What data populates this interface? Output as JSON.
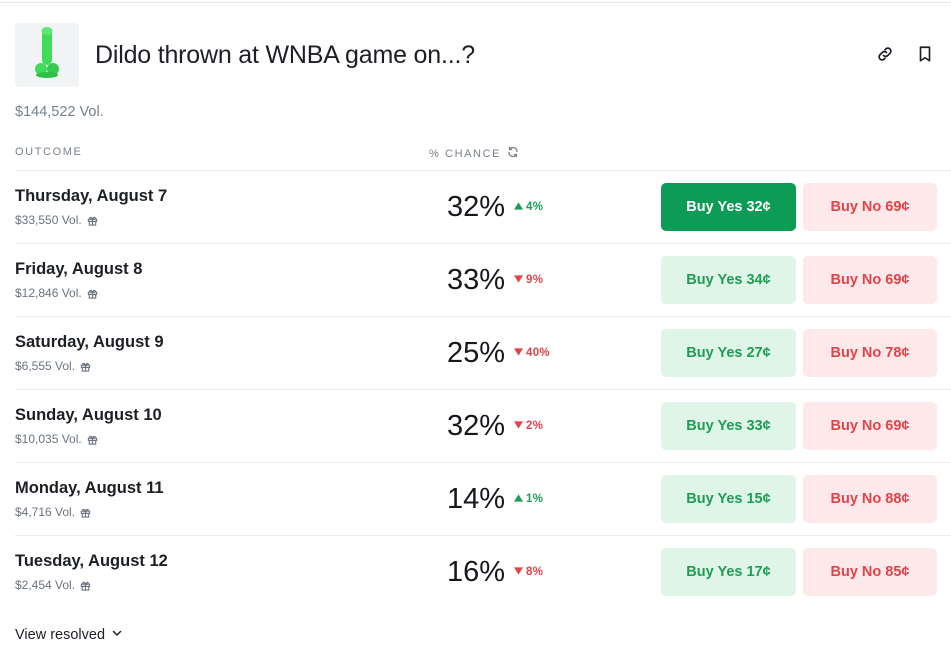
{
  "market": {
    "title": "Dildo thrown at WNBA game on...?",
    "volume": "$144,522 Vol.",
    "image_icon": "green-toy-icon"
  },
  "header_actions": {
    "link_icon": "link-icon",
    "bookmark_icon": "bookmark-icon"
  },
  "columns": {
    "outcome": "OUTCOME",
    "chance": "% CHANCE",
    "refresh_icon": "refresh-icon"
  },
  "outcomes": [
    {
      "name": "Thursday, August 7",
      "volume": "$33,550 Vol.",
      "chance": "32%",
      "delta": "4%",
      "direction": "up",
      "yes": "Buy Yes 32¢",
      "no": "Buy No 69¢",
      "yes_selected": true
    },
    {
      "name": "Friday, August 8",
      "volume": "$12,846 Vol.",
      "chance": "33%",
      "delta": "9%",
      "direction": "down",
      "yes": "Buy Yes 34¢",
      "no": "Buy No 69¢",
      "yes_selected": false
    },
    {
      "name": "Saturday, August 9",
      "volume": "$6,555 Vol.",
      "chance": "25%",
      "delta": "40%",
      "direction": "down",
      "yes": "Buy Yes 27¢",
      "no": "Buy No 78¢",
      "yes_selected": false
    },
    {
      "name": "Sunday, August 10",
      "volume": "$10,035 Vol.",
      "chance": "32%",
      "delta": "2%",
      "direction": "down",
      "yes": "Buy Yes 33¢",
      "no": "Buy No 69¢",
      "yes_selected": false
    },
    {
      "name": "Monday, August 11",
      "volume": "$4,716 Vol.",
      "chance": "14%",
      "delta": "1%",
      "direction": "up",
      "yes": "Buy Yes 15¢",
      "no": "Buy No 88¢",
      "yes_selected": false
    },
    {
      "name": "Tuesday, August 12",
      "volume": "$2,454 Vol.",
      "chance": "16%",
      "delta": "8%",
      "direction": "down",
      "yes": "Buy Yes 17¢",
      "no": "Buy No 85¢",
      "yes_selected": false
    }
  ],
  "footer": {
    "view_resolved": "View resolved"
  },
  "colors": {
    "yes_active_bg": "#0c9c56",
    "yes_bg": "#dff5e7",
    "yes_text": "#1f9d55",
    "no_bg": "#fde9ea",
    "no_text": "#e0444b"
  }
}
